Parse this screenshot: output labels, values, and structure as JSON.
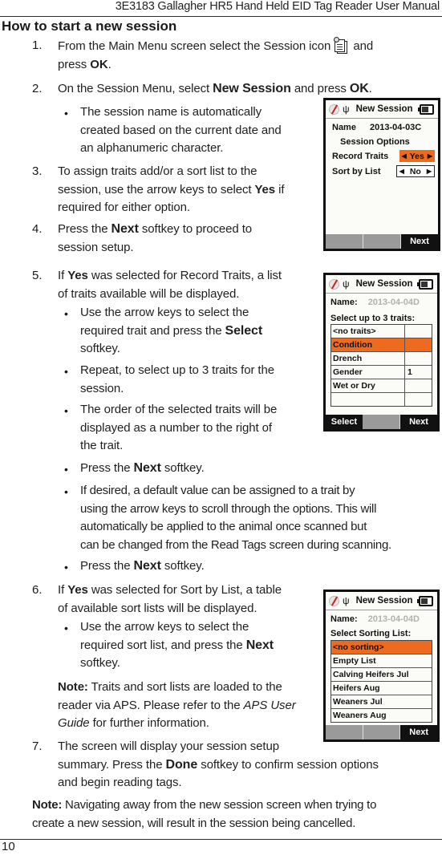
{
  "header": {
    "title": "3E3183 Gallagher HR5 Hand Held EID Tag Reader User Manual"
  },
  "section": {
    "title": "How to start a new session"
  },
  "steps": [
    {
      "num": "1.",
      "pre": "From the Main Menu screen select the Session icon",
      "icon": "session-icon",
      "post": " and",
      "line2_pre": "press ",
      "line2_bold": "OK",
      "line2_post": "."
    },
    {
      "num": "2.",
      "pre": "On the Session Menu, select ",
      "bold1": "New Session",
      "mid": " and press ",
      "bold2": "OK",
      "post": "."
    },
    {
      "num": "3.",
      "lines": [
        "To assign traits add/or a sort list to the",
        "session, use the arrow keys to select "
      ],
      "bold": "Yes",
      "post": " if",
      "line3": "required for either option."
    },
    {
      "num": "4.",
      "pre": "Press the ",
      "bold": "Next",
      "post": " softkey to proceed to",
      "line2": "session setup."
    },
    {
      "num": "5.",
      "pre": "If ",
      "bold": "Yes",
      "post": " was selected for Record Traits, a list",
      "line2": "of traits available will be displayed."
    },
    {
      "num": "6.",
      "pre": "If ",
      "bold": "Yes",
      "post": " was selected for Sort by List, a table",
      "line2": "of available sort lists will be displayed."
    },
    {
      "num": "7.",
      "line1": "The screen will display your session setup",
      "pre": "summary. Press the ",
      "bold": "Done",
      "post": " softkey to confirm session options",
      "line3": "and begin reading tags."
    }
  ],
  "bullets": {
    "session_name": [
      "The session name is automatically",
      "created based on the current date and",
      "an alphanumeric character."
    ],
    "select_trait": {
      "line1": "Use the arrow keys to select the",
      "pre": "required trait and press the ",
      "bold": "Select",
      "line3": "softkey."
    },
    "repeat": [
      "Repeat, to select up to 3 traits for the",
      "session."
    ],
    "order": [
      "The order of the selected traits will be",
      "displayed as a number to the right of",
      "the trait."
    ],
    "press_next_1": {
      "pre": "Press the ",
      "bold": "Next",
      "post": " softkey."
    },
    "default_value": [
      "If desired, a default value can be assigned to a trait by",
      "using the arrow keys to scroll through the options. This will",
      "automatically be applied to the animal once scanned but",
      "can be changed from the Read Tags screen during scanning."
    ],
    "press_next_2": {
      "pre": "Press the ",
      "bold": "Next",
      "post": " softkey."
    },
    "select_sort": {
      "line1": "Use the arrow keys to select the",
      "pre": "required sort list, and press the ",
      "bold": "Next",
      "line3": "softkey."
    }
  },
  "notes": {
    "aps": {
      "label": "Note:",
      "text1": " Traits and sort lists are loaded to the",
      "text2_pre": "reader via APS. Please refer to the ",
      "text2_italic": "APS User",
      "text3_italic": "Guide",
      "text3_post": " for further information."
    },
    "navigate": {
      "label": "Note:",
      "text1": " Navigating away from the new session screen when trying to",
      "text2": "create a new session, will result in the session being cancelled."
    }
  },
  "screens": {
    "options": {
      "title": "New Session",
      "name_label": "Name",
      "name_value": "2013-04-03C",
      "subheading": "Session Options",
      "rows": [
        {
          "label": "Record Traits",
          "value": "Yes",
          "selected": true
        },
        {
          "label": "Sort by List",
          "value": "No",
          "selected": false
        }
      ],
      "softkeys": [
        "",
        "",
        "Next"
      ]
    },
    "traits": {
      "title": "New Session",
      "name_label": "Name:",
      "name_value": "2013-04-04D",
      "prompt": "Select up to 3 traits:",
      "rows": [
        {
          "label": "<no traits>",
          "order": ""
        },
        {
          "label": "Condition",
          "order": "",
          "selected": true
        },
        {
          "label": "Drench",
          "order": ""
        },
        {
          "label": "Gender",
          "order": "1"
        },
        {
          "label": "Wet or Dry",
          "order": ""
        },
        {
          "label": "",
          "order": ""
        }
      ],
      "softkeys": [
        "Select",
        "",
        "Next"
      ]
    },
    "sorting": {
      "title": "New Session",
      "name_label": "Name:",
      "name_value": "2013-04-04D",
      "prompt": "Select Sorting List:",
      "rows": [
        {
          "label": "<no sorting>",
          "selected": true
        },
        {
          "label": "Empty List"
        },
        {
          "label": "Calving Heifers Jul"
        },
        {
          "label": "Heifers Aug"
        },
        {
          "label": "Weaners Jul"
        },
        {
          "label": "Weaners Aug"
        }
      ],
      "softkeys": [
        "",
        "",
        "Next"
      ]
    }
  },
  "colors": {
    "highlight": "#ee6a1f",
    "device_frame": "#111111",
    "softkey_inactive": "#9a9a9a"
  },
  "footer": {
    "page_number": "10"
  }
}
